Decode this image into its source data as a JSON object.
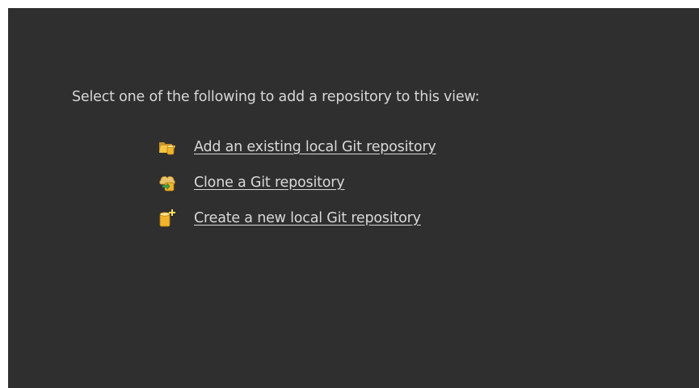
{
  "intro_text": "Select one of the following to add a repository to this view:",
  "links": [
    {
      "label": "Add an existing local Git repository",
      "icon": "open-folder-repository-icon"
    },
    {
      "label": "Clone a Git repository",
      "icon": "clone-repository-icon"
    },
    {
      "label": "Create a new local Git repository",
      "icon": "new-repository-icon"
    }
  ],
  "colors": {
    "background": "#2f2f2f",
    "text": "#d7d7d7",
    "icon_gold": "#f1b42b"
  }
}
